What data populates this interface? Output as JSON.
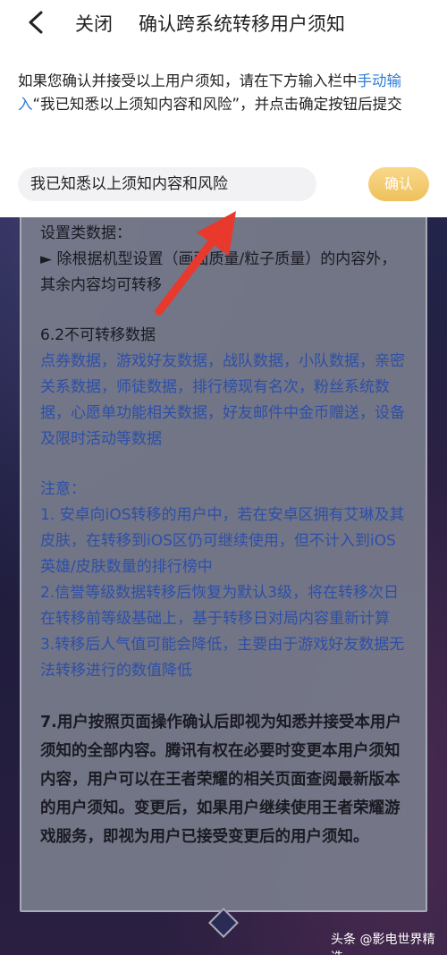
{
  "header": {
    "close_label": "关闭",
    "title": "确认跨系统转移用户须知"
  },
  "instruction": {
    "part1": "如果您确认并接受以上用户须知，请在下方输入栏中",
    "highlight": "手动输入",
    "part2": "“我已知悉以上须知内容和风险”，并点击确定按钮后提交"
  },
  "input": {
    "value": "我已知悉以上须知内容和风险"
  },
  "confirm_button": {
    "label": "确认"
  },
  "content": {
    "settings_heading": "设置类数据：",
    "settings_line": "► 除根据机型设置（画面质量/粒子质量）的内容外，其余内容均可转移",
    "section62_heading": "6.2不可转移数据",
    "section62_body": "点券数据，游戏好友数据，战队数据，小队数据，亲密关系数据，师徒数据，排行榜现有名次，粉丝系统数据，心愿单功能相关数据，好友邮件中金币赠送，设备及限时活动等数据",
    "notice_heading": "注意：",
    "notice_1": "1. 安卓向iOS转移的用户中，若在安卓区拥有艾琳及其皮肤，在转移到iOS区仍可继续使用，但不计入到iOS英雄/皮肤数量的排行榜中",
    "notice_2": "2.信誉等级数据转移后恢复为默认3级，将在转移次日在转移前等级基础上，基于转移日对局内容重新计算",
    "notice_3": "3.转移后人气值可能会降低，主要由于游戏好友数据无法转移进行的数值降低",
    "section7": "7.用户按照页面操作确认后即视为知悉并接受本用户须知的全部内容。腾讯有权在必要时变更本用户须知内容，用户可以在王者荣耀的相关页面查阅最新版本的用户须知。变更后，如果用户继续使用王者荣耀游戏服务，即视为用户已接受变更后的用户须知。"
  },
  "watermark": "头条 @影电世界精选",
  "colors": {
    "accent_blue": "#2d7bd6",
    "content_blue": "#2d4fa8",
    "confirm_gold": "#efc05a",
    "arrow_red": "#e8392c"
  }
}
